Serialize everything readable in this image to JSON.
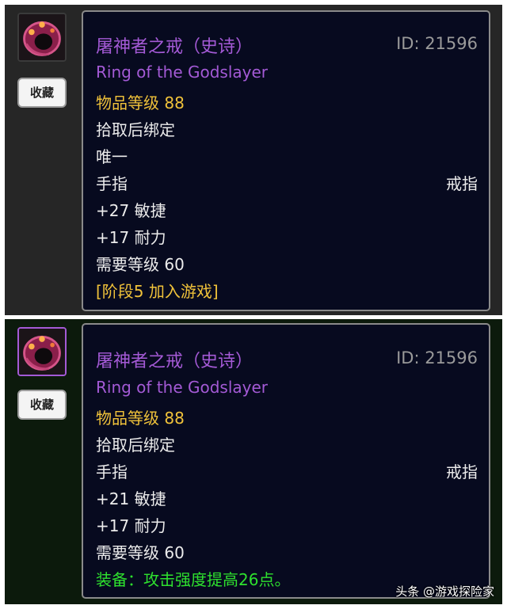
{
  "tooltip_top": {
    "item_name": "屠神者之戒（史诗）",
    "item_id": "ID: 21596",
    "english_name": "Ring of the Godslayer",
    "item_level": "物品等级 88",
    "bind": "拾取后绑定",
    "unique": "唯一",
    "slot": "手指",
    "type": "戒指",
    "stat_agility": "+27 敏捷",
    "stat_stamina": "+17 耐力",
    "required_level": "需要等级 60",
    "phase": "[阶段5 加入游戏]",
    "favorite_label": "收藏"
  },
  "tooltip_bottom": {
    "item_name": "屠神者之戒（史诗）",
    "item_id": "ID: 21596",
    "english_name": "Ring of the Godslayer",
    "item_level": "物品等级 88",
    "bind": "拾取后绑定",
    "slot": "手指",
    "type": "戒指",
    "stat_agility": "+21 敏捷",
    "stat_stamina": "+17 耐力",
    "required_level": "需要等级 60",
    "equip_effect": "装备：攻击强度提高26点。",
    "favorite_label": "收藏"
  },
  "watermark": "头条 @游戏探险家",
  "icons": {
    "item_icon": "ring-icon"
  },
  "colors": {
    "epic_purple": "#a45ad6",
    "item_level_yellow": "#f0c23a",
    "equip_green": "#2ee02e",
    "tooltip_background": "#070a1f"
  }
}
